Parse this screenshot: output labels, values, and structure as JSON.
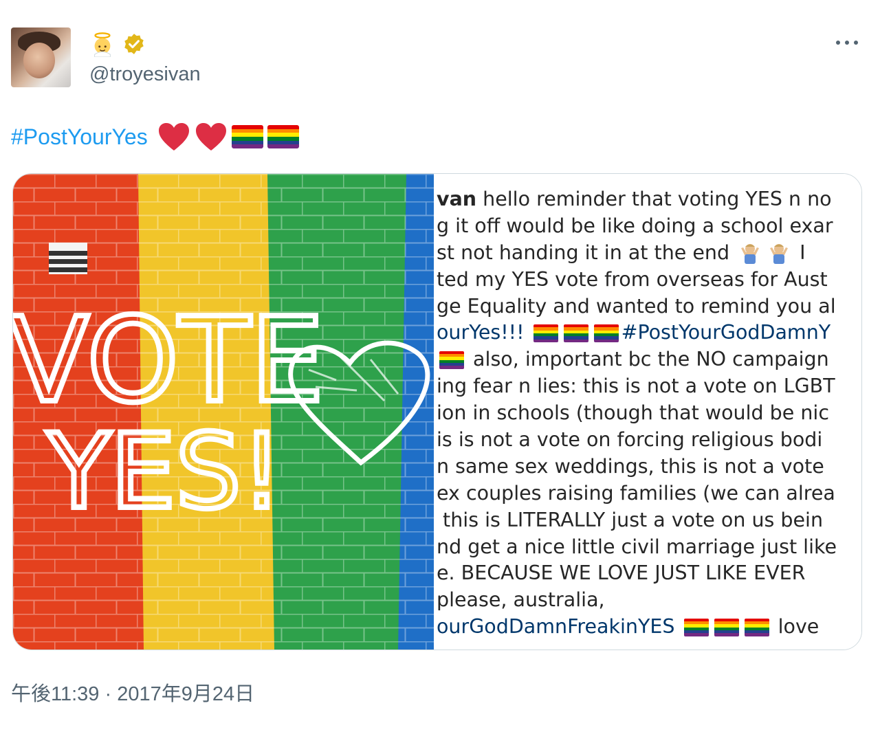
{
  "author": {
    "handle": "@troyesivan",
    "name_icons": [
      "angel-icon",
      "verified-badge-icon"
    ],
    "avatar": "profile-photo"
  },
  "more_icon": "more-dots-icon",
  "tweet": {
    "hashtag": "#PostYourYes",
    "emoji": [
      "red-heart-icon",
      "red-heart-icon",
      "rainbow-flag-icon",
      "rainbow-flag-icon"
    ]
  },
  "image": {
    "wall_text_top": "VOTE",
    "wall_text_bottom": "YES!",
    "caption_lines": [
      {
        "parts": [
          {
            "t": "b",
            "v": "van"
          },
          {
            "t": "txt",
            "v": " hello reminder that voting YES n no"
          }
        ]
      },
      {
        "parts": [
          {
            "t": "txt",
            "v": "g it off would be like doing a school exar"
          }
        ]
      },
      {
        "parts": [
          {
            "t": "txt",
            "v": "st not handing it in at the end "
          },
          {
            "t": "shrug"
          },
          {
            "t": "shrug"
          },
          {
            "t": "txt",
            "v": " I"
          }
        ]
      },
      {
        "parts": [
          {
            "t": "txt",
            "v": "ted my YES vote from overseas for Aust"
          }
        ]
      },
      {
        "parts": [
          {
            "t": "txt",
            "v": "ge Equality and wanted to remind you al"
          }
        ]
      },
      {
        "parts": [
          {
            "t": "tag",
            "v": "ourYes!!!"
          },
          {
            "t": "txt",
            "v": " "
          },
          {
            "t": "flag"
          },
          {
            "t": "flag"
          },
          {
            "t": "flag"
          },
          {
            "t": "tag",
            "v": "#PostYourGodDamnY"
          }
        ]
      },
      {
        "parts": [
          {
            "t": "flag"
          },
          {
            "t": "txt",
            "v": " also, important bc the NO campaign"
          }
        ]
      },
      {
        "parts": [
          {
            "t": "txt",
            "v": "ing fear n lies: this is not a vote on LGBT"
          }
        ]
      },
      {
        "parts": [
          {
            "t": "txt",
            "v": "ion in schools (though that would be nic"
          }
        ]
      },
      {
        "parts": [
          {
            "t": "txt",
            "v": "is is not a vote on forcing religious bodi"
          }
        ]
      },
      {
        "parts": [
          {
            "t": "txt",
            "v": "n same sex weddings, this is not a vote"
          }
        ]
      },
      {
        "parts": [
          {
            "t": "txt",
            "v": "ex couples raising families (we can alrea"
          }
        ]
      },
      {
        "parts": [
          {
            "t": "txt",
            "v": " this is LITERALLY just a vote on us bein"
          }
        ]
      },
      {
        "parts": [
          {
            "t": "txt",
            "v": "nd get a nice little civil marriage just like"
          }
        ]
      },
      {
        "parts": [
          {
            "t": "txt",
            "v": "e. BECAUSE WE LOVE JUST LIKE EVER"
          }
        ]
      },
      {
        "parts": [
          {
            "t": "txt",
            "v": "please, australia,"
          }
        ]
      },
      {
        "parts": [
          {
            "t": "tag",
            "v": "ourGodDamnFreakinYES"
          },
          {
            "t": "txt",
            "v": " "
          },
          {
            "t": "flag"
          },
          {
            "t": "flag"
          },
          {
            "t": "flag"
          },
          {
            "t": "txt",
            "v": " love"
          }
        ]
      }
    ]
  },
  "timestamp": "午後11:39 · 2017年9月24日",
  "colors": {
    "link_blue": "#1d9bf0",
    "secondary_text": "#536471",
    "instagram_tag": "#00376b",
    "rainbow": [
      "#e40303",
      "#ff8c00",
      "#ffed00",
      "#008026",
      "#24408e",
      "#732982"
    ]
  }
}
